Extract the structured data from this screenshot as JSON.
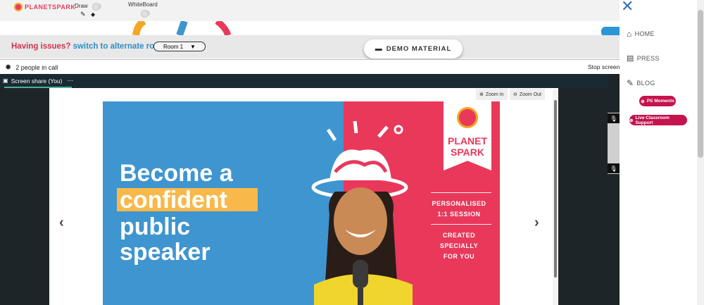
{
  "brand": {
    "logo_text": "PLANETSPARK"
  },
  "toolbar": {
    "draw_label": "Draw",
    "whiteboard_label": "WhiteBoard"
  },
  "issues": {
    "question": "Having issues?",
    "link": "switch to alternate room",
    "room_selected": "Room 1"
  },
  "demo_button": "DEMO MATERIAL",
  "call": {
    "people_count": "2 people in call",
    "stop_label": "Stop screen"
  },
  "screenshare_tab": "Screen share (You)",
  "screenshare_more": "⋯",
  "viewer": {
    "zoom_in": "Zoom In",
    "zoom_out": "Zoom Out"
  },
  "slide": {
    "line1": "Become a",
    "line2": "confident",
    "line3": "public",
    "line4": "speaker",
    "badge_line1": "PLANET",
    "badge_line2": "SPARK",
    "side1a": "PERSONALISED",
    "side1b": "1:1 SESSION",
    "side2a": "CREATED SPECIALLY",
    "side2b": "FOR YOU"
  },
  "nav": {
    "home": "HOME",
    "press": "PRESS",
    "blog": "BLOG",
    "ps_moments": "PS Moments",
    "live_support": "Live Classroom Support"
  },
  "colors": {
    "accent_red": "#c4134d",
    "link_blue": "#2f8dc8",
    "slide_blue": "#3e95d0",
    "slide_red": "#e9385a",
    "highlight_yellow": "#f8b94a"
  }
}
